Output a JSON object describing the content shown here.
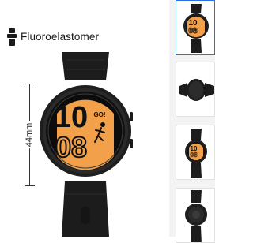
{
  "product": {
    "band_material": "Fluoroelastomer",
    "case_size": "44mm",
    "band_icon": "watch-band-icon"
  },
  "watch_face": {
    "hour": "10",
    "minute": "08",
    "badge": "GO!"
  },
  "thumbnails": [
    {
      "view": "front",
      "active": true
    },
    {
      "view": "side",
      "active": false
    },
    {
      "view": "angled",
      "active": false
    },
    {
      "view": "back",
      "active": false
    }
  ],
  "colors": {
    "accent": "#f2a04a",
    "selected_border": "#2f6ee0",
    "case": "#1e1e1e"
  }
}
